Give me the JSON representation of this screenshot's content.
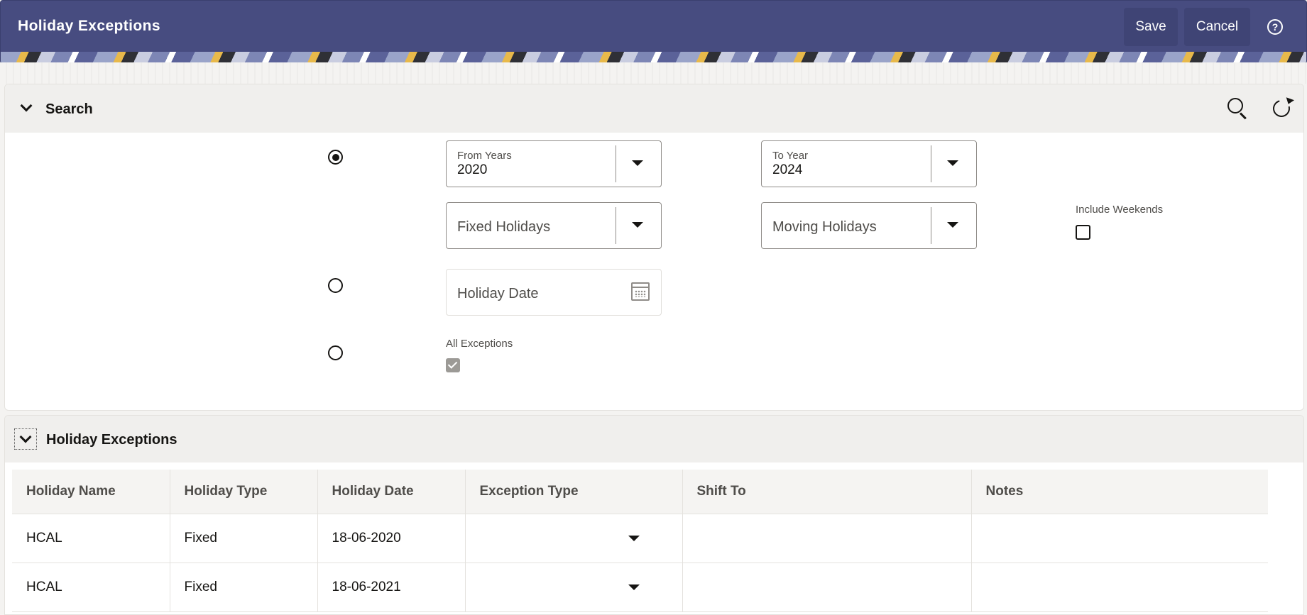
{
  "header": {
    "title": "Holiday Exceptions",
    "save_label": "Save",
    "cancel_label": "Cancel",
    "help_glyph": "?"
  },
  "search": {
    "title": "Search",
    "from_years": {
      "label": "From Years",
      "value": "2020"
    },
    "to_year": {
      "label": "To Year",
      "value": "2024"
    },
    "fixed_holidays_placeholder": "Fixed Holidays",
    "moving_holidays_placeholder": "Moving Holidays",
    "include_weekends_label": "Include Weekends",
    "holiday_date_placeholder": "Holiday Date",
    "all_exceptions_label": "All Exceptions"
  },
  "exceptions": {
    "title": "Holiday Exceptions",
    "columns": [
      "Holiday Name",
      "Holiday Type",
      "Holiday Date",
      "Exception Type",
      "Shift To",
      "Notes"
    ],
    "rows": [
      {
        "name": "HCAL",
        "type": "Fixed",
        "date": "18-06-2020",
        "exception_type": "",
        "shift_to": "",
        "notes": ""
      },
      {
        "name": "HCAL",
        "type": "Fixed",
        "date": "18-06-2021",
        "exception_type": "",
        "shift_to": "",
        "notes": ""
      }
    ]
  }
}
